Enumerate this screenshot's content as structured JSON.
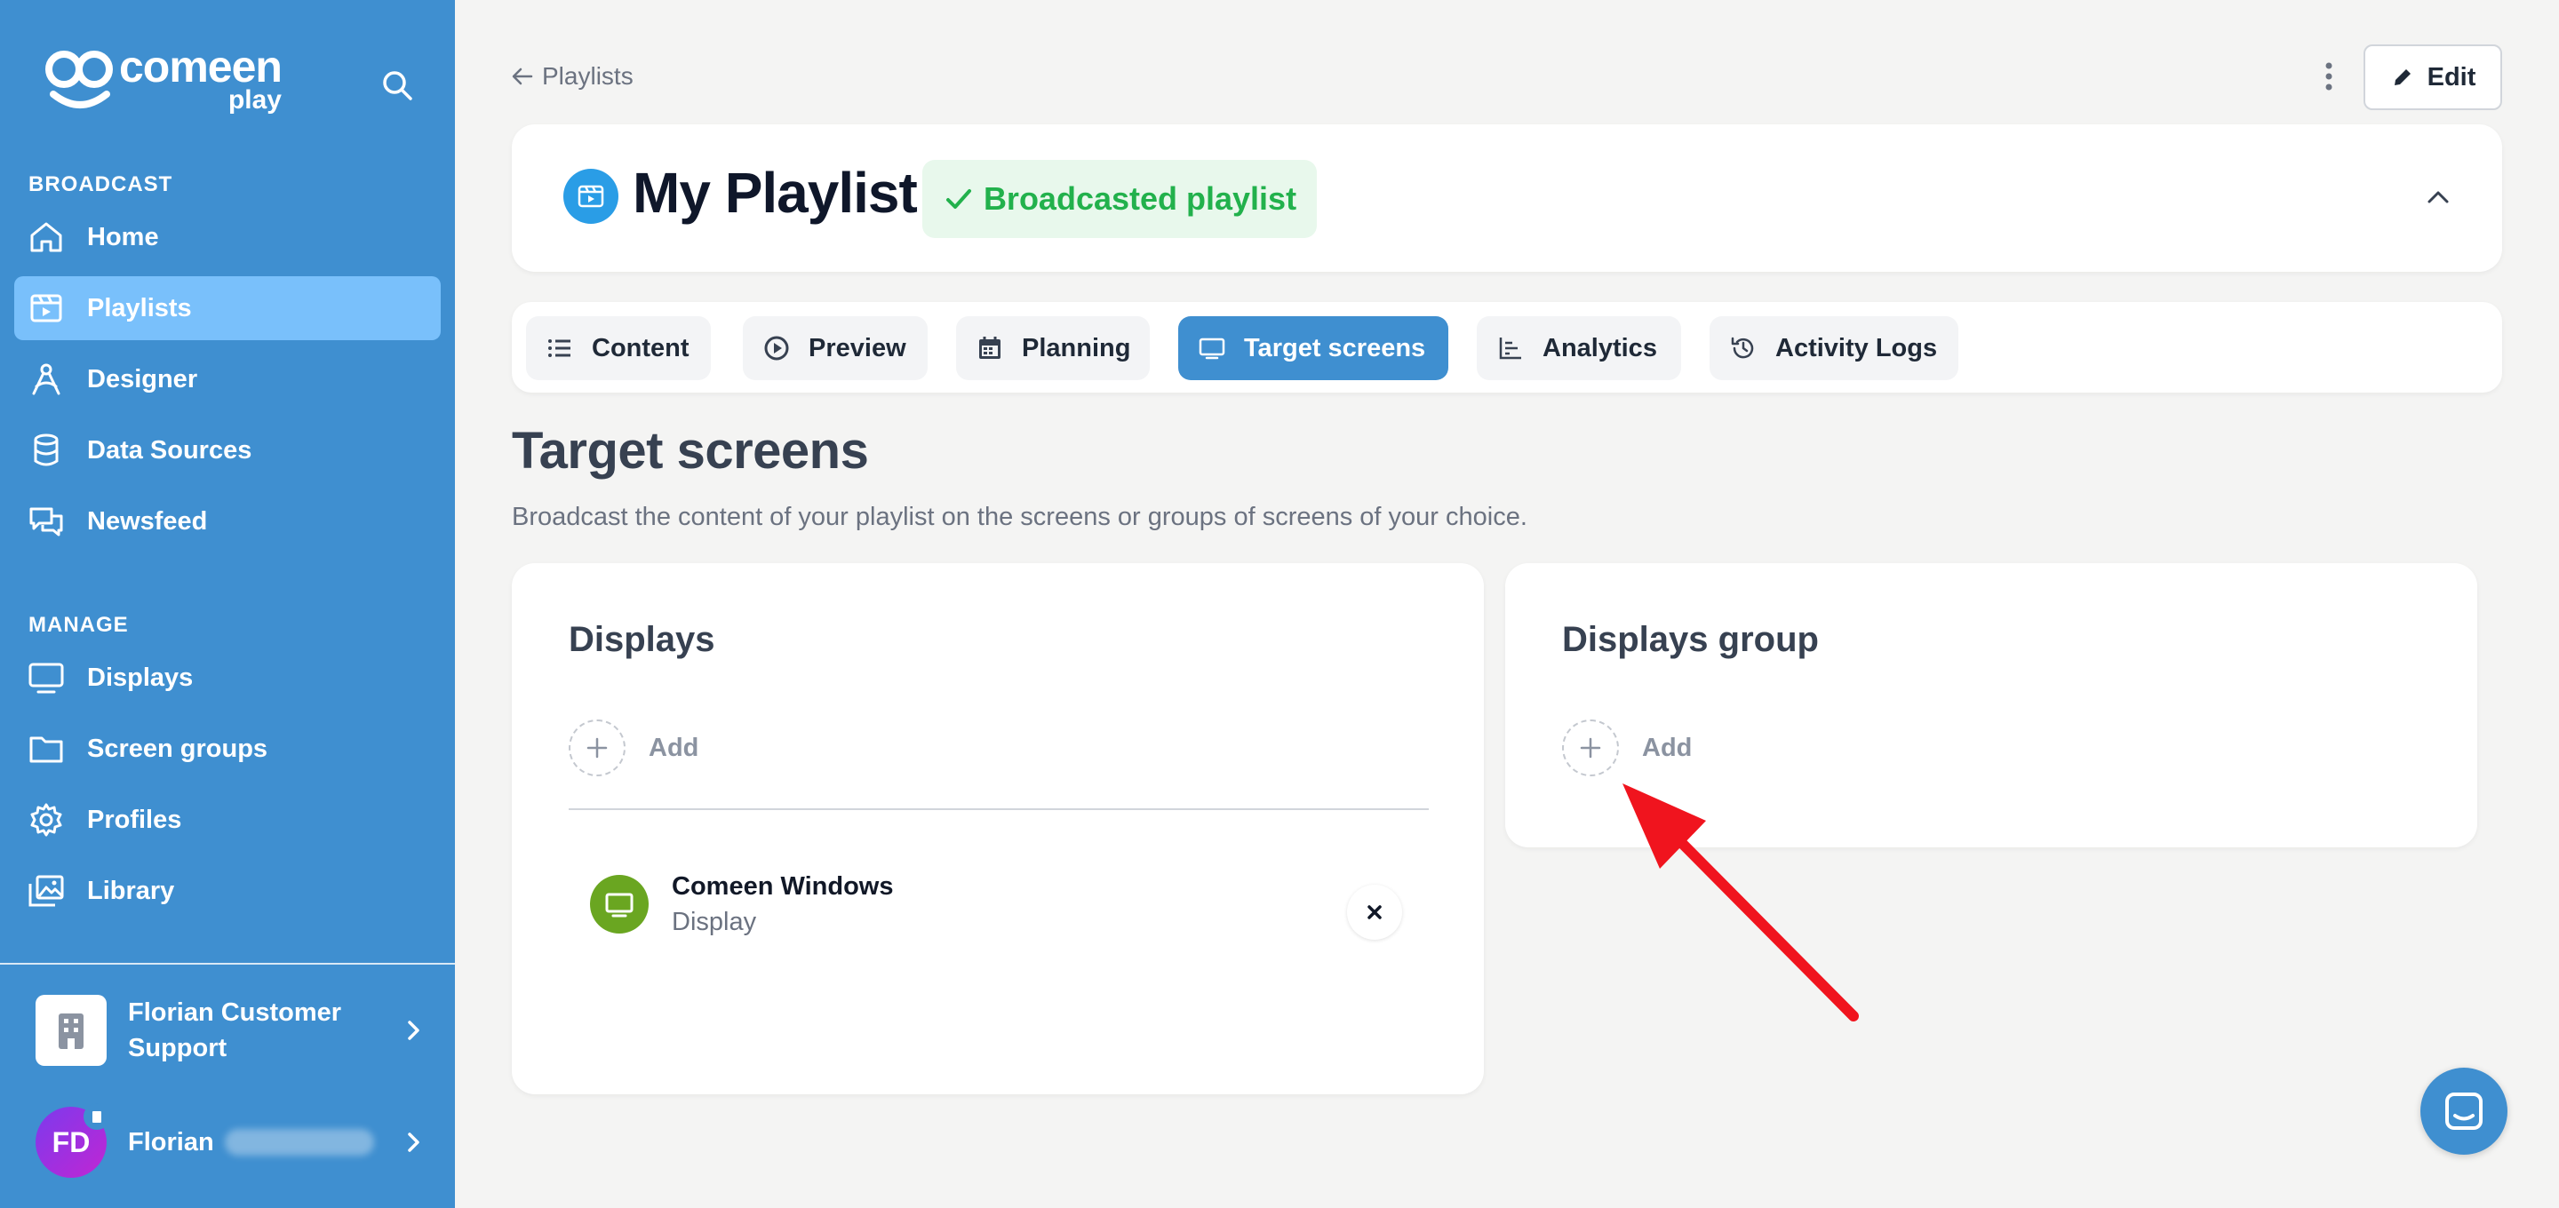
{
  "sidebar": {
    "logo": {
      "word": "comeen",
      "sub": "play"
    },
    "sections": {
      "broadcast": "BROADCAST",
      "manage": "MANAGE"
    },
    "broadcast_items": [
      {
        "label": "Home",
        "icon": "home-icon"
      },
      {
        "label": "Playlists",
        "icon": "playlist-icon",
        "active": true
      },
      {
        "label": "Designer",
        "icon": "designer-icon"
      },
      {
        "label": "Data Sources",
        "icon": "database-icon"
      },
      {
        "label": "Newsfeed",
        "icon": "chat-bubbles-icon"
      }
    ],
    "manage_items": [
      {
        "label": "Displays",
        "icon": "monitor-icon"
      },
      {
        "label": "Screen groups",
        "icon": "folder-icon"
      },
      {
        "label": "Profiles",
        "icon": "gear-icon"
      },
      {
        "label": "Library",
        "icon": "images-icon"
      }
    ],
    "organization": {
      "name": "Florian Customer Support"
    },
    "user": {
      "initials": "FD",
      "first_name": "Florian"
    }
  },
  "topbar": {
    "back_label": "Playlists",
    "edit_label": "Edit"
  },
  "header": {
    "title": "My Playlist",
    "status": "Broadcasted playlist",
    "status_color": "#22b14c"
  },
  "tabs": [
    {
      "label": "Content",
      "icon": "list-icon"
    },
    {
      "label": "Preview",
      "icon": "play-circle-icon"
    },
    {
      "label": "Planning",
      "icon": "calendar-icon"
    },
    {
      "label": "Target screens",
      "icon": "monitor-icon",
      "active": true
    },
    {
      "label": "Analytics",
      "icon": "bar-chart-icon"
    },
    {
      "label": "Activity Logs",
      "icon": "history-icon"
    }
  ],
  "page": {
    "title": "Target screens",
    "subtitle": "Broadcast the content of your playlist on the screens or groups of screens of your choice."
  },
  "displays_card": {
    "title": "Displays",
    "add_label": "Add",
    "items": [
      {
        "name": "Comeen Windows",
        "type": "Display"
      }
    ]
  },
  "groups_card": {
    "title": "Displays group",
    "add_label": "Add"
  },
  "colors": {
    "sidebar": "#3f8fd0",
    "active_nav": "#79c0fb",
    "accent": "#3f8fd0",
    "annotation_arrow": "#f0141e"
  }
}
